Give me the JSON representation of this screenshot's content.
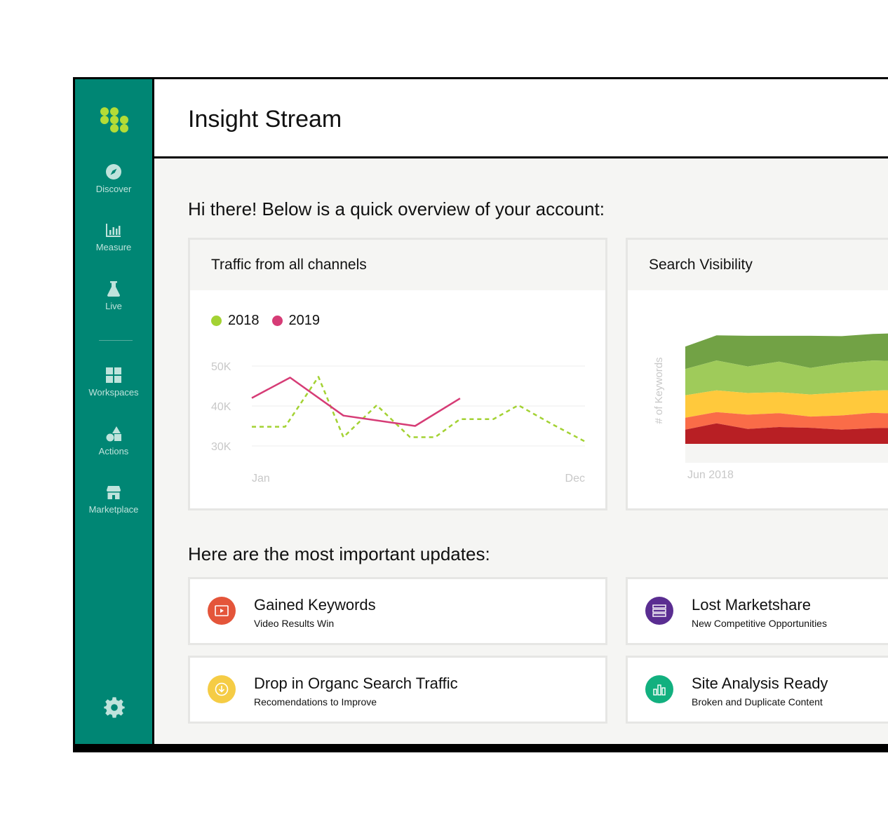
{
  "app": {
    "nav": [
      {
        "label": "Discover",
        "icon": "compass-icon"
      },
      {
        "label": "Measure",
        "icon": "bar-chart-icon"
      },
      {
        "label": "Live",
        "icon": "flask-icon"
      },
      {
        "label": "Workspaces",
        "icon": "grid-icon"
      },
      {
        "label": "Actions",
        "icon": "shapes-icon"
      },
      {
        "label": "Marketplace",
        "icon": "store-icon"
      }
    ],
    "settings_icon": "gear-icon"
  },
  "header": {
    "title": "Insight Stream"
  },
  "overview": {
    "heading": "Hi there! Below is a quick overview of your account:"
  },
  "traffic_card": {
    "title": "Traffic from all channels",
    "legend": [
      {
        "name": "2018",
        "color": "#a3d233"
      },
      {
        "name": "2019",
        "color": "#d63c76"
      }
    ]
  },
  "visibility_card": {
    "title": "Search Visibility"
  },
  "updates": {
    "heading": "Here are the most important updates:",
    "items": [
      {
        "title": "Gained Keywords",
        "subtitle": "Video Results Win",
        "icon": "video-icon",
        "color": "#e4553a"
      },
      {
        "title": "Lost Marketshare",
        "subtitle": "New Competitive Opportunities",
        "icon": "list-icon",
        "color": "#5a2d91"
      },
      {
        "title": "Drop in Organc Search Traffic",
        "subtitle": "Recomendations to Improve",
        "icon": "download-circle-icon",
        "color": "#f5cc45"
      },
      {
        "title": "Site Analysis Ready",
        "subtitle": "Broken and Duplicate Content",
        "icon": "bar-chart-icon",
        "color": "#12b07f"
      }
    ]
  },
  "chart_data": [
    {
      "type": "line",
      "title": "Traffic from all channels",
      "x_start_label": "Jan",
      "x_end_label": "Dec",
      "yticks": [
        "50K",
        "40K",
        "30K"
      ],
      "ylim": [
        25000,
        55000
      ],
      "xlim": [
        0,
        20
      ],
      "grid": true,
      "legend": "top-left",
      "series": [
        {
          "name": "2018",
          "color": "#a3d233",
          "dashed": true,
          "x": [
            0,
            2,
            4,
            5.5,
            7.5,
            9.5,
            11,
            12.5,
            14.5,
            16,
            18,
            20
          ],
          "y": [
            34800,
            34800,
            47300,
            32200,
            40200,
            32200,
            32200,
            36700,
            36700,
            40200,
            35500,
            31100
          ]
        },
        {
          "name": "2019",
          "color": "#d63c76",
          "dashed": false,
          "x": [
            0,
            2.3,
            5.5,
            9.8,
            12.5
          ],
          "y": [
            42000,
            47100,
            37600,
            35000,
            41900
          ]
        }
      ]
    },
    {
      "type": "area",
      "title": "Search Visibility",
      "ylabel": "# of Keywords",
      "x_start_label": "Jun 2018",
      "xlim": [
        0,
        7
      ],
      "ylim": [
        0,
        30
      ],
      "series": [
        {
          "name": "",
          "color": "#b81f24",
          "values": [
            3.8,
            5.5,
            4.0,
            4.5,
            4.3,
            3.8,
            4.2,
            4.3
          ]
        },
        {
          "name": "",
          "color": "#fa6c48",
          "values": [
            7.0,
            8.5,
            7.8,
            8.2,
            7.3,
            7.6,
            8.3,
            8.0
          ]
        },
        {
          "name": "",
          "color": "#ffc93c",
          "values": [
            13.0,
            14.3,
            13.6,
            13.8,
            13.2,
            13.7,
            14.2,
            14.5
          ]
        },
        {
          "name": "",
          "color": "#9fcb5a",
          "values": [
            20.0,
            22.3,
            20.7,
            22.0,
            20.3,
            21.6,
            22.3,
            22.1
          ]
        },
        {
          "name": "",
          "color": "#72a245",
          "values": [
            26.0,
            29.0,
            28.9,
            28.9,
            28.9,
            28.8,
            29.4,
            29.6
          ]
        }
      ]
    }
  ]
}
